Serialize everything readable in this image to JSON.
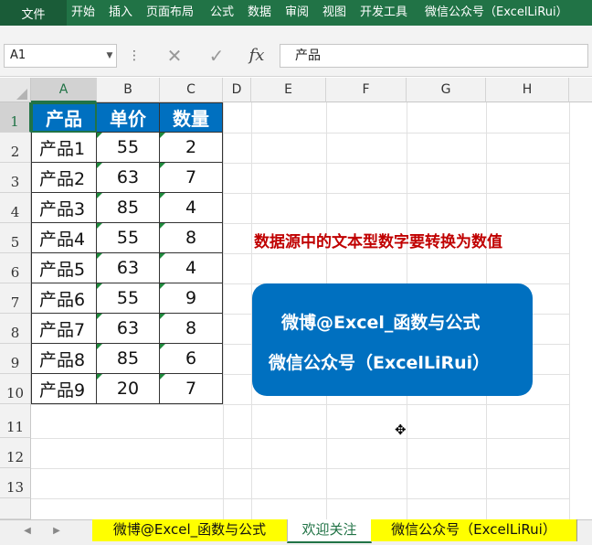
{
  "ribbon": {
    "file": "文件",
    "tabs": [
      "开始",
      "插入",
      "页面布局",
      "公式",
      "数据",
      "审阅",
      "视图",
      "开发工具",
      "微信公众号（ExcelLiRui）"
    ]
  },
  "formula_bar": {
    "name_box": "A1",
    "cancel_icon": "✕",
    "enter_icon": "✓",
    "fx_icon": "fx",
    "formula": "产品"
  },
  "columns": [
    "A",
    "B",
    "C",
    "D",
    "E",
    "F",
    "G",
    "H"
  ],
  "rows": [
    "1",
    "2",
    "3",
    "4",
    "5",
    "6",
    "7",
    "8",
    "9",
    "10",
    "11",
    "12",
    "13"
  ],
  "table": {
    "headers": [
      "产品",
      "单价",
      "数量"
    ],
    "rows": [
      [
        "产品1",
        "55",
        "2"
      ],
      [
        "产品2",
        "63",
        "7"
      ],
      [
        "产品3",
        "85",
        "4"
      ],
      [
        "产品4",
        "55",
        "8"
      ],
      [
        "产品5",
        "63",
        "4"
      ],
      [
        "产品6",
        "55",
        "9"
      ],
      [
        "产品7",
        "63",
        "8"
      ],
      [
        "产品8",
        "85",
        "6"
      ],
      [
        "产品9",
        "20",
        "7"
      ]
    ]
  },
  "note": "数据源中的文本型数字要转换为数值",
  "banner": {
    "line1": "微博@Excel_函数与公式",
    "line2": "微信公众号（ExcelLiRui）"
  },
  "sheet_tabs": [
    "微博@Excel_函数与公式",
    "欢迎关注",
    "微信公众号（ExcelLiRui）"
  ],
  "colors": {
    "ribbon": "#217346",
    "table_header": "#0070c0",
    "note": "#c00000",
    "tab_highlight": "#ffff00",
    "text_number_indicator": "#1e8a3c"
  }
}
